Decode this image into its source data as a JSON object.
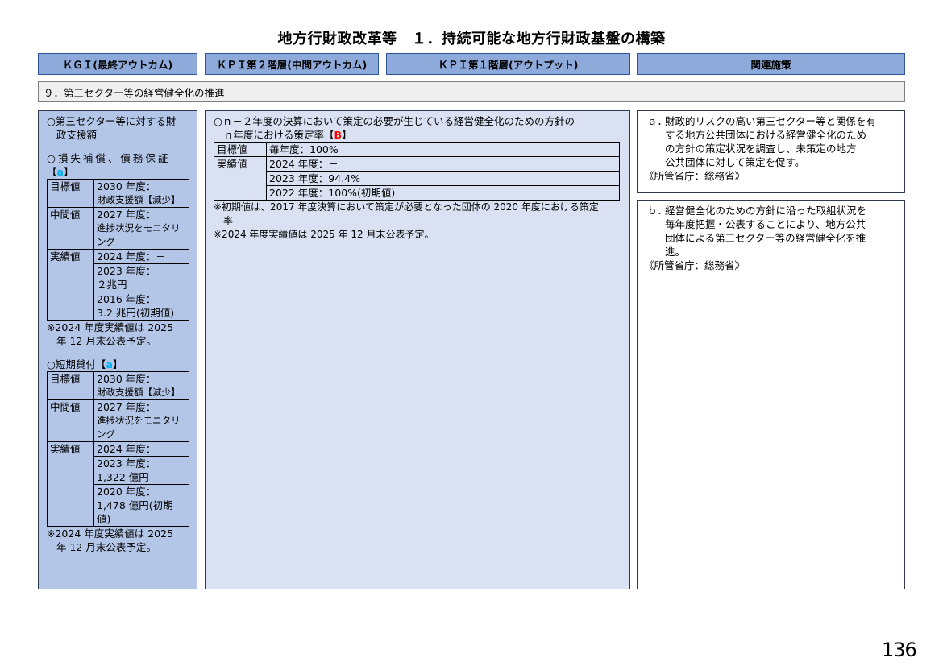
{
  "title": "地方行財政改革等　１．持続可能な地方行財政基盤の構築",
  "headers": {
    "kgi": "ＫＧＩ(最終アウトカム)",
    "kpi2": "ＫＰＩ第２階層(中間アウトカム)",
    "kpi1": "ＫＰＩ第１階層(アウトプット)",
    "related": "関連施策"
  },
  "section_title": "９．第三セクター等の経営健全化の推進",
  "kgi": {
    "heading_1": "○第三セクター等に対する財",
    "heading_2": "政支援額",
    "group1": {
      "title": "○損失補償、債務保証",
      "badge_open": "【",
      "badge": "a",
      "badge_close": "】",
      "target_label": "目標値",
      "target_1": "2030 年度：",
      "target_2": "財政支援額【減少】",
      "mid_label": "中間値",
      "mid_1": "2027 年度：",
      "mid_2": "進捗状況をモニタリ",
      "mid_3": "ング",
      "actual_label": "実績値",
      "actual_a": "2024 年度：－",
      "actual_b1": "2023 年度：",
      "actual_b2": "２兆円",
      "actual_c1": "2016 年度：",
      "actual_c2": "3.2 兆円(初期値)"
    },
    "note1_1": "※2024 年度実績値は 2025",
    "note1_2": "年 12 月末公表予定。",
    "group2": {
      "title": "○短期貸付",
      "badge_open": "【",
      "badge": "a",
      "badge_close": "】",
      "target_label": "目標値",
      "target_1": "2030 年度：",
      "target_2": "財政支援額【減少】",
      "mid_label": "中間値",
      "mid_1": "2027 年度：",
      "mid_2": "進捗状況をモニタリ",
      "mid_3": "ング",
      "actual_label": "実績値",
      "actual_a": "2024 年度：－",
      "actual_b1": "2023 年度：",
      "actual_b2": "1,322 億円",
      "actual_c1": "2020 年度：",
      "actual_c2": "1,478 億円(初期",
      "actual_c3": "値)"
    },
    "note2_1": "※2024 年度実績値は 2025",
    "note2_2": "年 12 月末公表予定。"
  },
  "kpi": {
    "heading_1": "○ｎ－２年度の決算において策定の必要が生じている経営健全化のための方針の",
    "heading_2": "ｎ年度における策定率",
    "badge_open": "【",
    "badge": "B",
    "badge_close": "】",
    "target_label": "目標値",
    "target": "毎年度：100%",
    "actual_label": "実績値",
    "actual_1": "2024 年度：－",
    "actual_2": "2023 年度：94.4%",
    "actual_3": "2022 年度：100%(初期値)",
    "note_1": "※初期値は、2017 年度決算において策定が必要となった団体の 2020 年度における策定",
    "note_2": "率",
    "note_3": "※2024 年度実績値は 2025 年 12 月末公表予定。"
  },
  "related": {
    "a_mark": "ａ．",
    "a_1": "財政的リスクの高い第三セクター等と関係を有",
    "a_2": "する地方公共団体における経営健全化のため",
    "a_3": "の方針の策定状況を調査し、未策定の地方",
    "a_4": "公共団体に対して策定を促す。",
    "a_ministry": "《所管省庁：総務省》",
    "b_mark": "ｂ．",
    "b_1": "経営健全化のための方針に沿った取組状況を",
    "b_2": "毎年度把握・公表することにより、地方公共",
    "b_3": "団体による第三セクター等の経営健全化を推",
    "b_4": "進。",
    "b_ministry": "《所管省庁：総務省》"
  },
  "page_number": "136"
}
